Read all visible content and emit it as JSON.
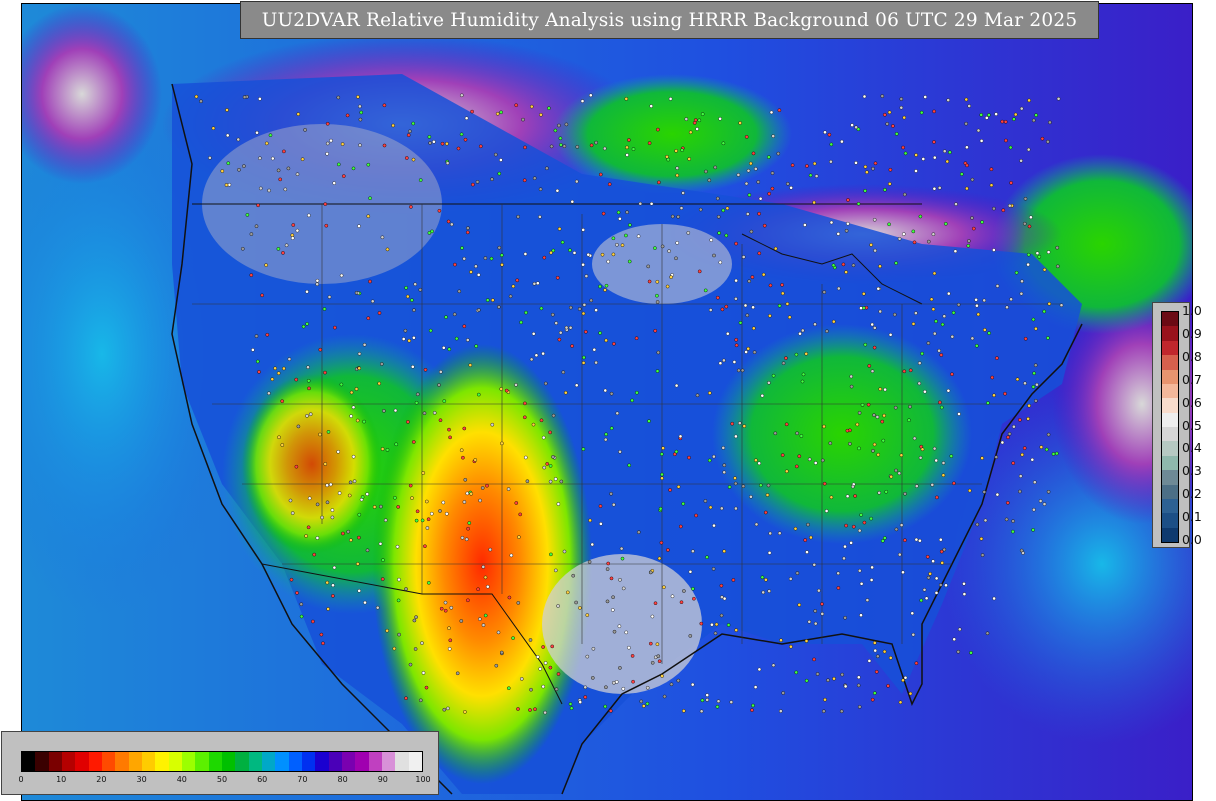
{
  "title": "UU2DVAR Relative Humidity Analysis using HRRR Background 06 UTC 29 Mar 2025",
  "legend": {
    "ticks": [
      "0",
      "10",
      "20",
      "30",
      "40",
      "50",
      "60",
      "70",
      "80",
      "90",
      "100"
    ],
    "colors": [
      "#000000",
      "#3a0000",
      "#7a0000",
      "#b50000",
      "#e00000",
      "#ff1a00",
      "#ff4a00",
      "#ff7a00",
      "#ffa600",
      "#ffcc00",
      "#fff200",
      "#d8ff00",
      "#9cff00",
      "#5cf000",
      "#1ed800",
      "#00c000",
      "#00b040",
      "#00b880",
      "#00a8c8",
      "#0090ff",
      "#0060ff",
      "#0030f0",
      "#1a00d0",
      "#4a00b8",
      "#7a00b0",
      "#a000b0",
      "#c040c0",
      "#d890d8",
      "#e0e0e0",
      "#f0f0f0"
    ]
  },
  "uncertainty_scale": {
    "ticks": [
      "1.0",
      "0.9",
      "0.8",
      "0.7",
      "0.6",
      "0.5",
      "0.4",
      "0.3",
      "0.2",
      "0.1",
      "0.0"
    ],
    "colors": [
      "#6b0a14",
      "#99121c",
      "#c0272d",
      "#d6604d",
      "#e8946f",
      "#f4b89b",
      "#f8dccc",
      "#eeeeee",
      "#d6d6d6",
      "#b6c9c2",
      "#8fb8ac",
      "#6e8a96",
      "#4c6f86",
      "#2d6193",
      "#1c4f86",
      "#0e3a6f"
    ]
  }
}
